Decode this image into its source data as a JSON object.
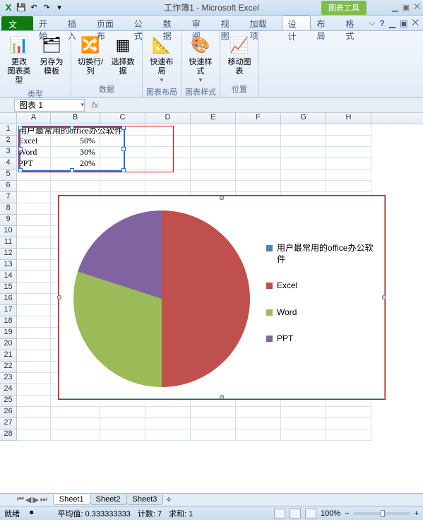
{
  "title": "工作簿1 - Microsoft Excel",
  "chart_tools_label": "图表工具",
  "tabs": {
    "file": "文件",
    "home": "开始",
    "insert": "插入",
    "pagelayout": "页面布",
    "formulas": "公式",
    "data": "数据",
    "review": "审阅",
    "view": "视图",
    "addins": "加载项",
    "design": "设计",
    "layout": "布局",
    "format": "格式"
  },
  "ribbon": {
    "groups": {
      "type": "类型",
      "data": "数据",
      "chart_layout": "图表布局",
      "chart_style": "图表样式",
      "location": "位置"
    },
    "buttons": {
      "change_chart_type": "更改\n图表类型",
      "save_as_template": "另存为\n模板",
      "switch_row_col": "切换行/列",
      "select_data": "选择数据",
      "quick_layout": "快速布局",
      "quick_style": "快速样式",
      "move_chart": "移动图表"
    }
  },
  "namebox": "图表 1",
  "fx_label": "fx",
  "columns": [
    "A",
    "B",
    "C",
    "D",
    "E",
    "F",
    "G",
    "H"
  ],
  "cells": {
    "a1_span": "用户最常用的office办公软件",
    "a2": "Excel",
    "b2": "50%",
    "a3": "Word",
    "b3": "30%",
    "a4": "PPT",
    "b4": "20%"
  },
  "chart_data": {
    "type": "pie",
    "title": "用户最常用的office办公软件",
    "categories": [
      "Excel",
      "Word",
      "PPT"
    ],
    "values": [
      0.5,
      0.3,
      0.2
    ],
    "colors": [
      "#c0504d",
      "#9bbb59",
      "#8064a2"
    ],
    "legend_entries": [
      "用户最常用的office办公软件",
      "Excel",
      "Word",
      "PPT"
    ]
  },
  "sheet_tabs": [
    "Sheet1",
    "Sheet2",
    "Sheet3"
  ],
  "status": {
    "ready": "就绪",
    "avg_label": "平均值:",
    "avg": "0.333333333",
    "count_label": "计数:",
    "count": "7",
    "sum_label": "求和:",
    "sum": "1",
    "zoom": "100%",
    "minus": "−",
    "plus": "+"
  }
}
